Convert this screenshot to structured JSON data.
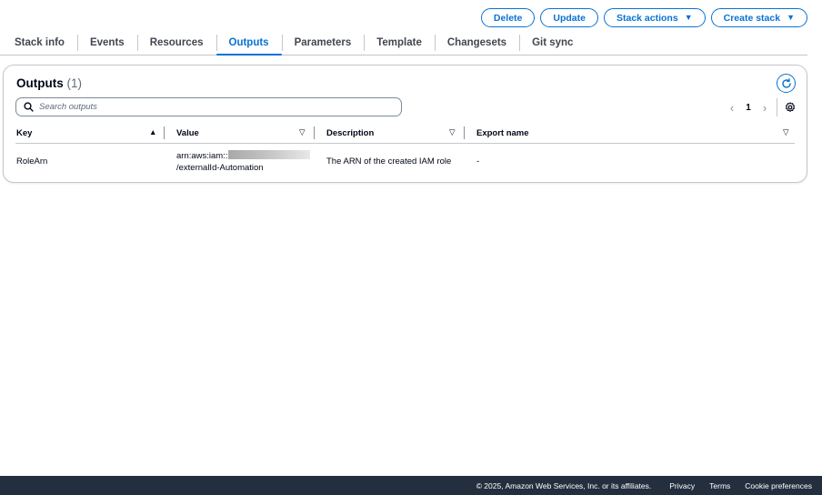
{
  "actions": {
    "delete_label": "Delete",
    "update_label": "Update",
    "stack_actions_label": "Stack actions",
    "create_stack_label": "Create stack"
  },
  "tabs": [
    {
      "label": "Stack info"
    },
    {
      "label": "Events"
    },
    {
      "label": "Resources"
    },
    {
      "label": "Outputs",
      "active": true
    },
    {
      "label": "Parameters"
    },
    {
      "label": "Template"
    },
    {
      "label": "Changesets"
    },
    {
      "label": "Git sync"
    }
  ],
  "outputs": {
    "title": "Outputs",
    "count": "(1)",
    "search_placeholder": "Search outputs",
    "current_page": "1",
    "columns": {
      "key": "Key",
      "value": "Value",
      "description": "Description",
      "export_name": "Export name"
    },
    "rows": [
      {
        "key": "RoleArn",
        "value_prefix": "arn:aws:iam::",
        "value_suffix": "/externalId-Automation",
        "description": "The ARN of the created IAM role",
        "export_name": "-"
      }
    ]
  },
  "footer": {
    "copyright": "© 2025, Amazon Web Services, Inc. or its affiliates.",
    "privacy": "Privacy",
    "terms": "Terms",
    "cookies": "Cookie preferences"
  },
  "colors": {
    "accent": "#0972d3",
    "text": "#000716",
    "footer_bg": "#232f3e"
  },
  "icons": {
    "refresh": "refresh-icon",
    "search": "search-icon",
    "settings": "gear-icon",
    "sort_asc": "sort-ascending-icon",
    "sort_none": "sort-indicator-icon"
  }
}
